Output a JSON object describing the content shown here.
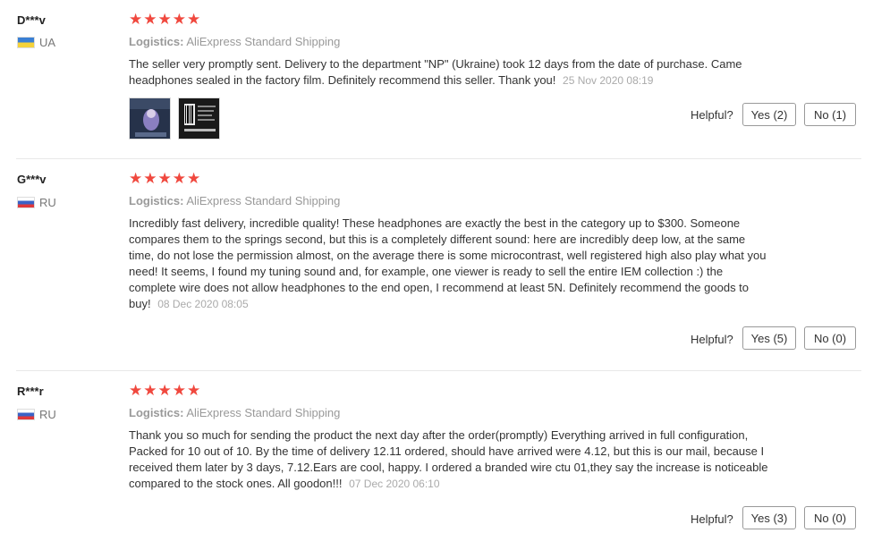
{
  "reviews": [
    {
      "user": "D***v",
      "country": "UA",
      "flag": "ukraine-flag-icon",
      "rating": "★★★★★",
      "logistics_label": "Logistics:",
      "logistics_value": "AliExpress Standard Shipping",
      "text": "The seller very promptly sent. Delivery to the department \"NP\" (Ukraine) took 12 days from the date of purchase. Came headphones sealed in the factory film. Definitely recommend this seller. Thank you!",
      "date": "25 Nov 2020 08:19",
      "helpful_label": "Helpful?",
      "yes_label": "Yes (2)",
      "no_label": "No (1)"
    },
    {
      "user": "G***v",
      "country": "RU",
      "flag": "russia-flag-icon",
      "rating": "★★★★★",
      "logistics_label": "Logistics:",
      "logistics_value": "AliExpress Standard Shipping",
      "text": "Incredibly fast delivery, incredible quality! These headphones are exactly the best in the category up to $300. Someone compares them to the springs second, but this is a completely different sound: here are incredibly deep low, at the same time, do not lose the permission almost, on the average there is some microcontrast, well registered high also play what you need! It seems, I found my tuning sound and, for example, one viewer is ready to sell the entire IEM collection :) the complete wire does not allow headphones to the end open, I recommend at least 5N. Definitely recommend the goods to buy!",
      "date": "08 Dec 2020 08:05",
      "helpful_label": "Helpful?",
      "yes_label": "Yes (5)",
      "no_label": "No (0)"
    },
    {
      "user": "R***r",
      "country": "RU",
      "flag": "russia-flag-icon",
      "rating": "★★★★★",
      "logistics_label": "Logistics:",
      "logistics_value": "AliExpress Standard Shipping",
      "text": "Thank you so much for sending the product the next day after the order(promptly) Everything arrived in full configuration, Packed for 10 out of 10. By the time of delivery 12.11 ordered, should have arrived were 4.12, but this is our mail, because I received them later by 3 days, 7.12.Ears are cool, happy. I ordered a branded wire ctu 01,they say the increase is noticeable compared to the stock ones. All goodon!!!",
      "date": "07 Dec 2020 06:10",
      "helpful_label": "Helpful?",
      "yes_label": "Yes (3)",
      "no_label": "No (0)"
    }
  ],
  "colors": {
    "star": "#f0483e",
    "muted": "#999999",
    "divider": "#e8e8e8"
  }
}
